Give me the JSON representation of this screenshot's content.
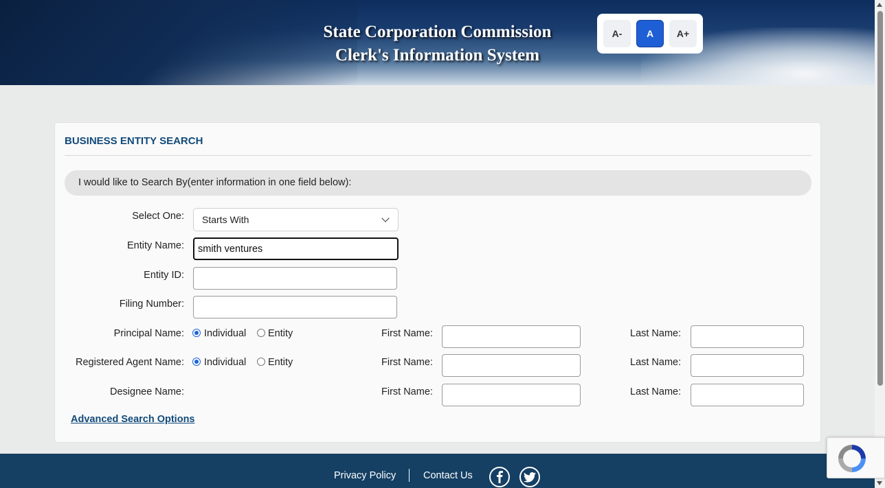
{
  "header": {
    "title_line1": "State Corporation Commission",
    "title_line2": "Clerk's Information System",
    "font_controls": {
      "decrease": "A-",
      "normal": "A",
      "increase": "A+"
    }
  },
  "form": {
    "title": "BUSINESS ENTITY SEARCH",
    "search_by_text": "I would like to Search By(enter information in one field below):",
    "select_one_label": "Select One:",
    "select_one_value": "Starts With",
    "entity_name_label": "Entity Name:",
    "entity_name_value": "smith ventures",
    "entity_id_label": "Entity ID:",
    "filing_number_label": "Filing Number:",
    "principal_name_label": "Principal Name:",
    "registered_agent_label": "Registered Agent Name:",
    "designee_name_label": "Designee Name:",
    "individual_label": "Individual",
    "entity_label": "Entity",
    "first_name_label": "First Name:",
    "last_name_label": "Last Name:",
    "advanced_link": "Advanced Search Options"
  },
  "footer": {
    "privacy": "Privacy Policy",
    "contact": "Contact Us"
  },
  "colors": {
    "accent": "#1e5fd6",
    "heading": "#114a7a",
    "footer_bg": "#154064"
  }
}
